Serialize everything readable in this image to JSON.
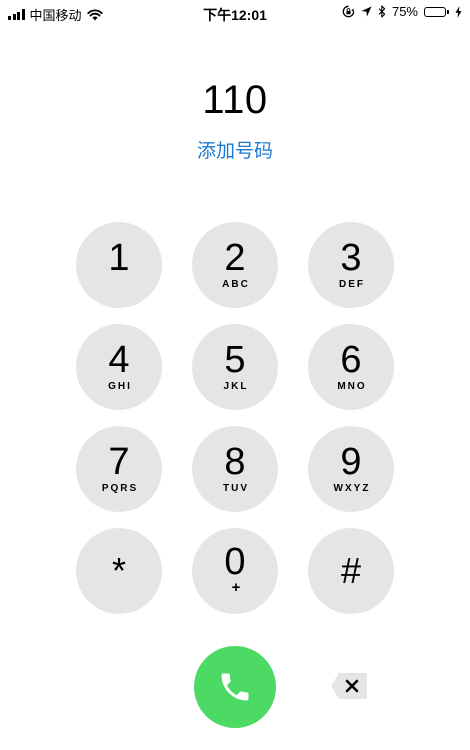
{
  "status_bar": {
    "carrier": "中国移动",
    "time": "下午12:01",
    "battery_percent": "75%",
    "battery_level": 0.75,
    "icons": [
      "signal-icon",
      "wifi-icon",
      "orientation-lock-icon",
      "location-icon",
      "bluetooth-icon",
      "battery-icon",
      "charging-icon"
    ]
  },
  "dialer": {
    "entered_number": "110",
    "add_number_label": "添加号码",
    "keys": [
      {
        "digit": "1",
        "letters": ""
      },
      {
        "digit": "2",
        "letters": "ABC"
      },
      {
        "digit": "3",
        "letters": "DEF"
      },
      {
        "digit": "4",
        "letters": "GHI"
      },
      {
        "digit": "5",
        "letters": "JKL"
      },
      {
        "digit": "6",
        "letters": "MNO"
      },
      {
        "digit": "7",
        "letters": "PQRS"
      },
      {
        "digit": "8",
        "letters": "TUV"
      },
      {
        "digit": "9",
        "letters": "WXYZ"
      },
      {
        "digit": "*",
        "letters": ""
      },
      {
        "digit": "0",
        "letters": "+"
      },
      {
        "digit": "#",
        "letters": ""
      }
    ],
    "call_icon": "phone-icon",
    "delete_icon": "delete-icon"
  },
  "colors": {
    "accent": "#1a7ad4",
    "call_green": "#4cd964",
    "key_background": "#e5e5e5"
  }
}
